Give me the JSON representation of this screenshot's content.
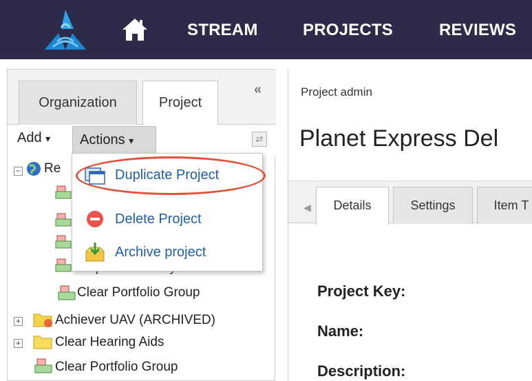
{
  "nav": {
    "items": [
      "STREAM",
      "PROJECTS",
      "REVIEWS"
    ],
    "logo_icon": "triangle-logo-icon",
    "home_icon": "home-icon"
  },
  "left_panel": {
    "tabs": [
      "Organization",
      "Project"
    ],
    "active_tab": "Project",
    "collapse_glyph": "«",
    "toolbar": {
      "add_label": "Add",
      "actions_label": "Actions",
      "caret": "▾"
    },
    "tree": {
      "root_label_partial": "Re",
      "hidden_label_partial": "Corporate Library",
      "rows": [
        {
          "label": "Clear Portfolio Group",
          "icon": "group-icon"
        },
        {
          "label": "Achiever UAV (ARCHIVED)",
          "icon": "archived-folder-icon"
        },
        {
          "label": "Clear Hearing Aids",
          "icon": "folder-icon"
        },
        {
          "label": "Clear Portfolio Group",
          "icon": "group-icon"
        }
      ]
    },
    "actions_menu": [
      {
        "label": "Duplicate Project",
        "icon": "duplicate-icon"
      },
      {
        "label": "Delete Project",
        "icon": "delete-icon"
      },
      {
        "label": "Archive project",
        "icon": "archive-icon"
      }
    ]
  },
  "right_panel": {
    "breadcrumb": "Project admin",
    "title": "Planet Express Del",
    "tabs": [
      "Details",
      "Settings",
      "Item T"
    ],
    "active_tab": "Details",
    "fields": [
      "Project Key:",
      "Name:",
      "Description:"
    ]
  },
  "colors": {
    "topbar": "#2d2a4a",
    "link": "#1f5fa8",
    "highlight": "#e2523a"
  }
}
